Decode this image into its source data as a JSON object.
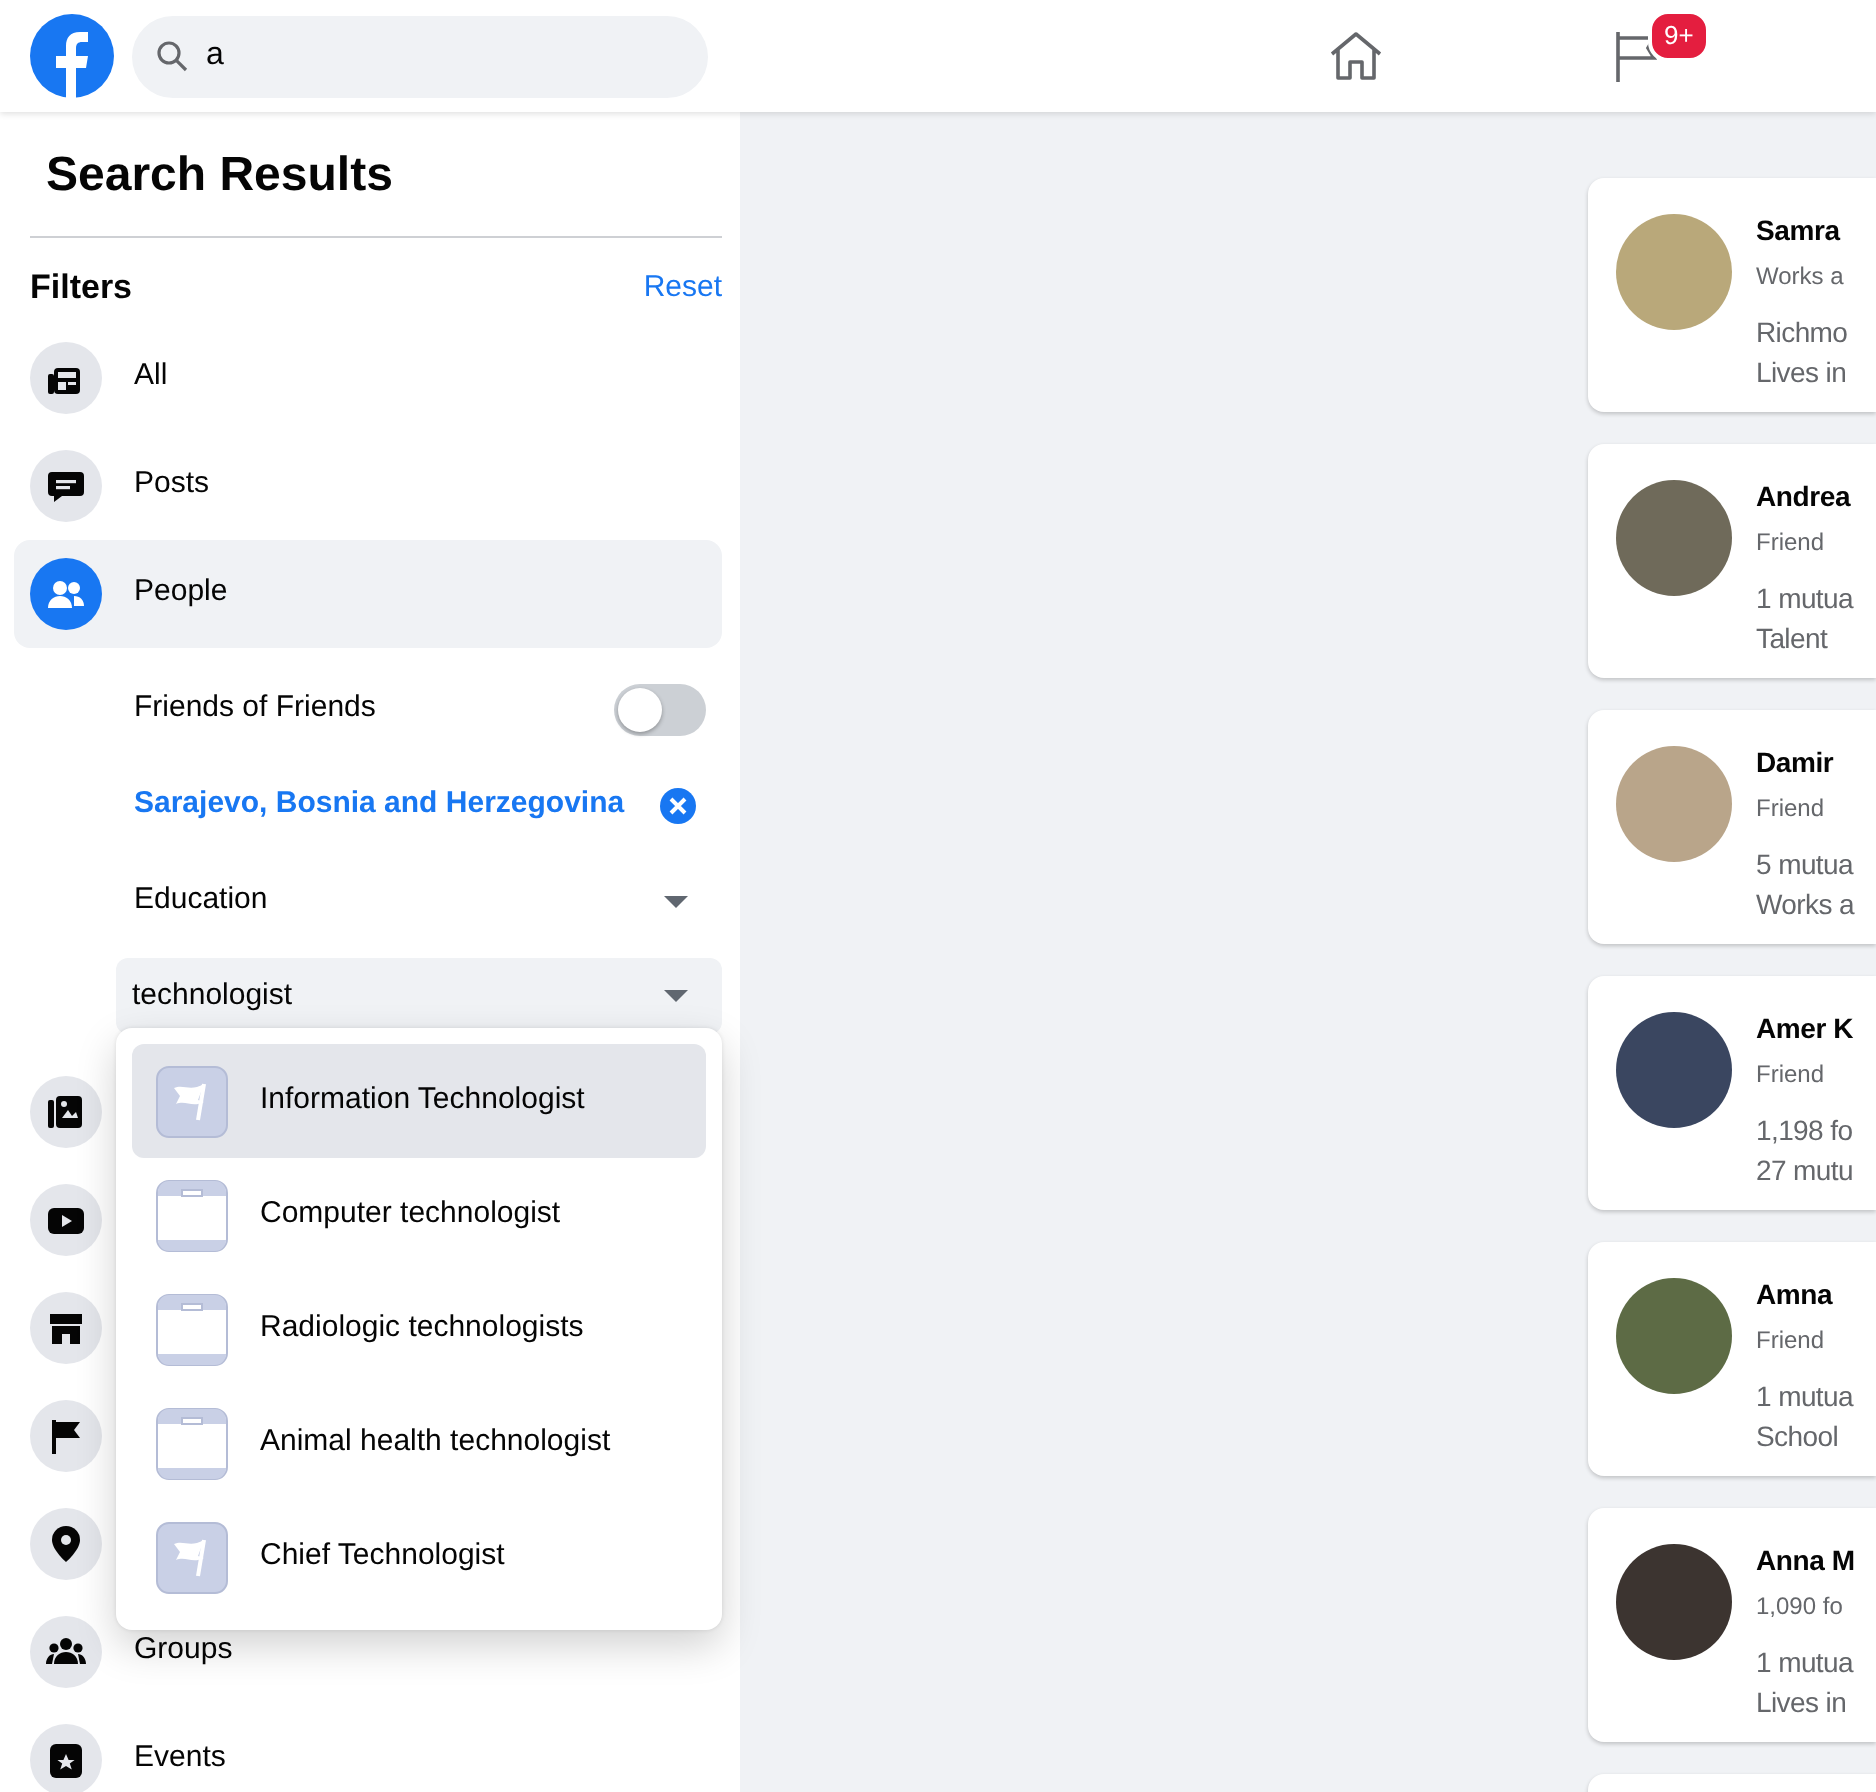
{
  "topbar": {
    "search": {
      "value": "a"
    },
    "notifications_badge": "9+"
  },
  "sidebar": {
    "title": "Search Results",
    "filters_label": "Filters",
    "reset": "Reset",
    "filters": [
      {
        "kind": "all",
        "label": "All",
        "selected": false
      },
      {
        "kind": "posts",
        "label": "Posts",
        "selected": false
      },
      {
        "kind": "people",
        "label": "People",
        "selected": true
      }
    ],
    "people_options": {
      "friends_of_friends": {
        "label": "Friends of Friends",
        "on": false
      },
      "location": "Sarajevo, Bosnia and Herzegovina",
      "education": "Education",
      "education_field": {
        "value": "technologist"
      }
    },
    "more_filters": [
      {
        "kind": "photos"
      },
      {
        "kind": "videos"
      },
      {
        "kind": "marketplace"
      },
      {
        "kind": "pages"
      },
      {
        "kind": "places"
      },
      {
        "kind": "groups",
        "label": "Groups"
      },
      {
        "kind": "events",
        "label": "Events"
      }
    ]
  },
  "suggestions": [
    {
      "kind": "flag",
      "label": "Information Technologist",
      "selected": true
    },
    {
      "kind": "briefcase",
      "label": "Computer technologist",
      "selected": false
    },
    {
      "kind": "briefcase",
      "label": "Radiologic technologists",
      "selected": false
    },
    {
      "kind": "briefcase",
      "label": "Animal health technologist",
      "selected": false
    },
    {
      "kind": "flag",
      "label": "Chief Technologist",
      "selected": false
    }
  ],
  "results": [
    {
      "name": "Samra",
      "subtitle": "Works a",
      "line_1": "Richmo",
      "line_2": "Lives in"
    },
    {
      "name": "Andrea",
      "subtitle": "Friend",
      "line_1": "1 mutua",
      "line_2": "Talent"
    },
    {
      "name": "Damir",
      "subtitle": "Friend",
      "line_1": "5 mutua",
      "line_2": "Works a"
    },
    {
      "name": "Amer K",
      "subtitle": "Friend",
      "line_1": "1,198 fo",
      "line_2": "27 mutu"
    },
    {
      "name": "Amna",
      "subtitle": "Friend",
      "line_1": "1 mutua",
      "line_2": "School"
    },
    {
      "name": "Anna M",
      "subtitle": "1,090 fo",
      "line_1": "1 mutua",
      "line_2": "Lives in"
    }
  ]
}
